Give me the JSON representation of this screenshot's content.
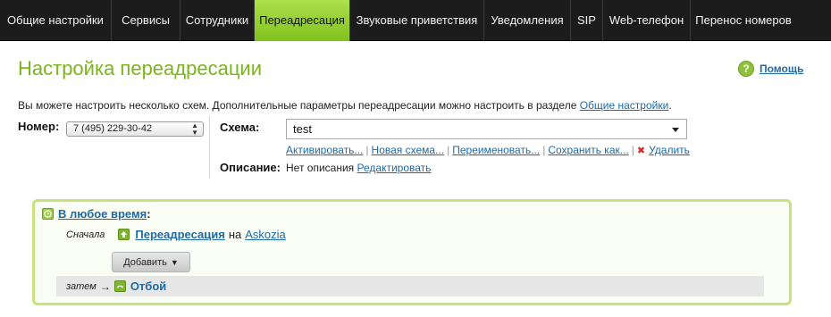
{
  "nav": {
    "items": [
      {
        "label": "Общие настройки",
        "active": false
      },
      {
        "label": "Сервисы",
        "active": false
      },
      {
        "label": "Сотрудники",
        "active": false
      },
      {
        "label": "Переадресация",
        "active": true
      },
      {
        "label": "Звуковые приветствия",
        "active": false
      },
      {
        "label": "Уведомления",
        "active": false
      },
      {
        "label": "SIP",
        "active": false
      },
      {
        "label": "Web-телефон",
        "active": false
      },
      {
        "label": "Перенос номеров",
        "active": false
      }
    ]
  },
  "page": {
    "title": "Настройка переадресации",
    "help_label": "Помощь",
    "help_icon": "question-icon"
  },
  "intro": {
    "text": "Вы можете настроить несколько схем. Дополнительные параметры переадресации можно настроить в разделе ",
    "link": "Общие настройки",
    "end": "."
  },
  "number": {
    "label": "Номер:",
    "value": "7 (495) 229-30-42"
  },
  "scheme": {
    "label": "Схема:",
    "value": "test",
    "actions": {
      "activate": "Активировать...",
      "new": "Новая схема...",
      "rename": "Переименовать...",
      "save_as": "Сохранить как...",
      "delete": "Удалить"
    },
    "description_label": "Описание:",
    "description_value": "Нет описания",
    "edit_link": "Редактировать"
  },
  "rule": {
    "time_link": "В любое время",
    "time_suffix": ":",
    "first_label": "Сначала",
    "forward_link": "Переадресация",
    "on_word": "на",
    "target_link": "Askozia",
    "add_button": "Добавить",
    "add_arrow": "▼",
    "then_label": "затем",
    "then_arrow": "→",
    "hangup_label": "Отбой"
  },
  "colors": {
    "nav_bg": "#1c1c1c",
    "nav_active": "#8fcc2a",
    "title_green": "#7ab51d",
    "link_blue": "#1f6aa3",
    "panel_border": "#c7e27e",
    "delete_red": "#e02020"
  }
}
